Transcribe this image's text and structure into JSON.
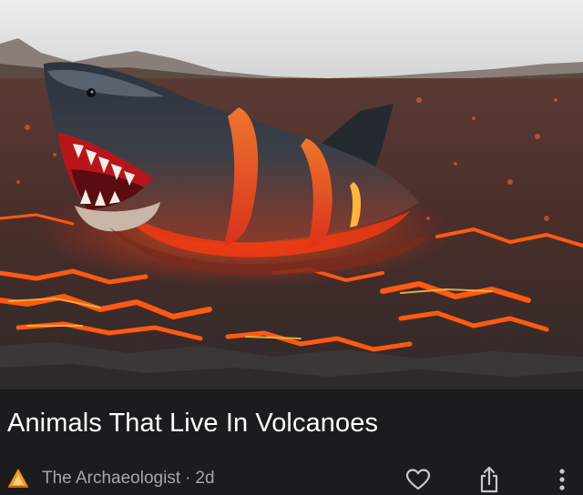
{
  "card": {
    "image_alt": "Shark emerging from lava",
    "title": "Animals That Live In Volcanoes",
    "source": "The Archaeologist",
    "separator": "·",
    "age": "2d"
  },
  "icons": {
    "source_logo": "archaeologist-logo-icon",
    "like": "heart-icon",
    "share": "share-icon",
    "more": "more-vertical-icon"
  },
  "colors": {
    "background": "#1c1c1e",
    "title": "#ffffff",
    "meta": "#a6a6aa",
    "lava": "#ff4a1a"
  }
}
